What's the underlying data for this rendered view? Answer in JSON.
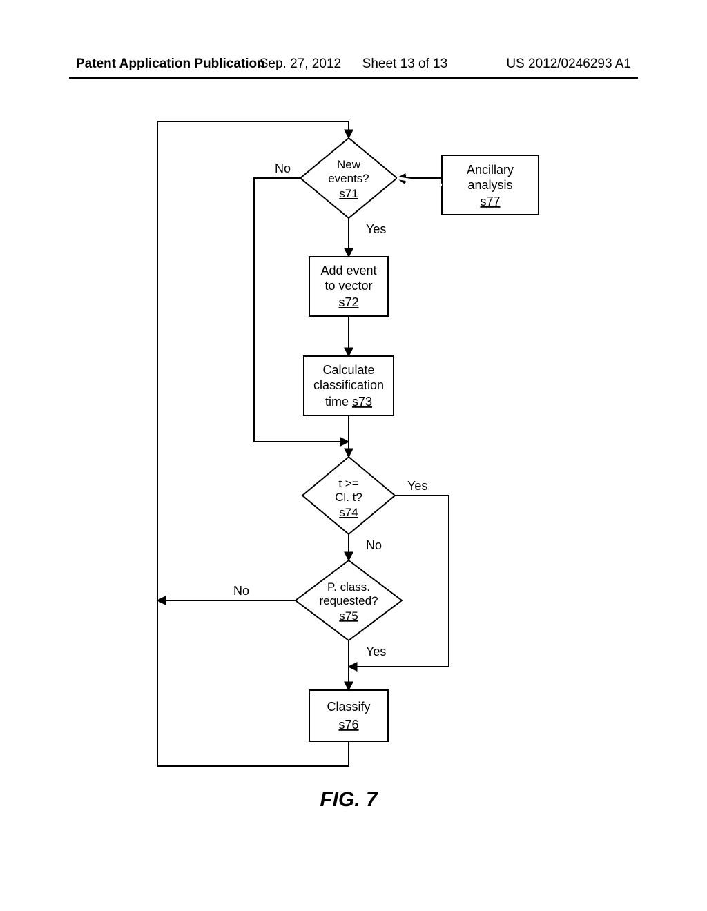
{
  "header": {
    "left": "Patent Application Publication",
    "center_date": "Sep. 27, 2012",
    "center_sheet": "Sheet 13 of 13",
    "right": "US 2012/0246293 A1"
  },
  "labels": {
    "no": "No",
    "yes": "Yes"
  },
  "d71": {
    "l1": "New",
    "l2": "events?",
    "step": "s71"
  },
  "b77": {
    "l1": "Ancillary",
    "l2": "analysis",
    "step": "s77"
  },
  "b72": {
    "l1": "Add event",
    "l2": "to vector",
    "step": "s72"
  },
  "b73": {
    "l1": "Calculate",
    "l2": "classification",
    "l3_a": "time",
    "step": "s73"
  },
  "d74": {
    "l1": "t >=",
    "l2": "Cl. t?",
    "step": "s74"
  },
  "d75": {
    "l1": "P. class.",
    "l2": "requested?",
    "step": "s75"
  },
  "b76": {
    "l1": "Classify",
    "step": "s76"
  },
  "figure": "FIG. 7"
}
